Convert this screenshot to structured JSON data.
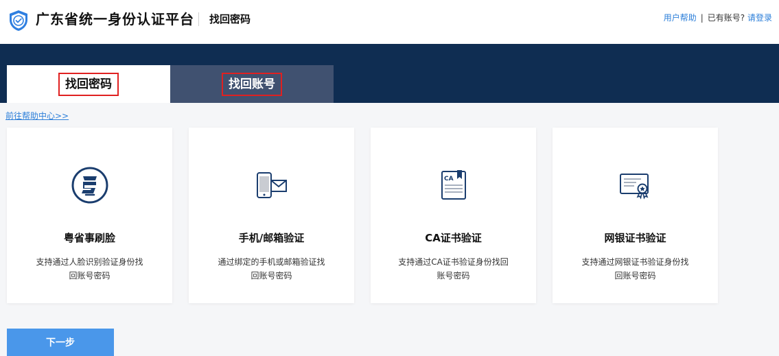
{
  "header": {
    "app_title": "广东省统一身份认证平台",
    "page_subtitle": "找回密码",
    "help_link": "用户帮助",
    "separator": "|",
    "have_account": "已有账号?",
    "login_link": "请登录"
  },
  "tabs": [
    {
      "label": "找回密码",
      "active": true
    },
    {
      "label": "找回账号",
      "active": false
    }
  ],
  "help_center_link": "前往帮助中心>>",
  "methods": [
    {
      "icon": "yue-face-icon",
      "title": "粤省事刷脸",
      "desc": "支持通过人脸识别验证身份找回账号密码"
    },
    {
      "icon": "phone-mail-icon",
      "title": "手机/邮箱验证",
      "desc": "通过绑定的手机或邮箱验证找回账号密码"
    },
    {
      "icon": "ca-certificate-icon",
      "title": "CA证书验证",
      "desc": "支持通过CA证书验证身份找回账号密码"
    },
    {
      "icon": "bank-certificate-icon",
      "title": "网银证书验证",
      "desc": "支持通过网银证书验证身份找回账号密码"
    }
  ],
  "next_button": "下一步",
  "colors": {
    "banner": "#0f2d52",
    "inactive_tab": "#405170",
    "link": "#2d7fd9",
    "button": "#4a97ea",
    "highlight_border": "#e02020"
  }
}
